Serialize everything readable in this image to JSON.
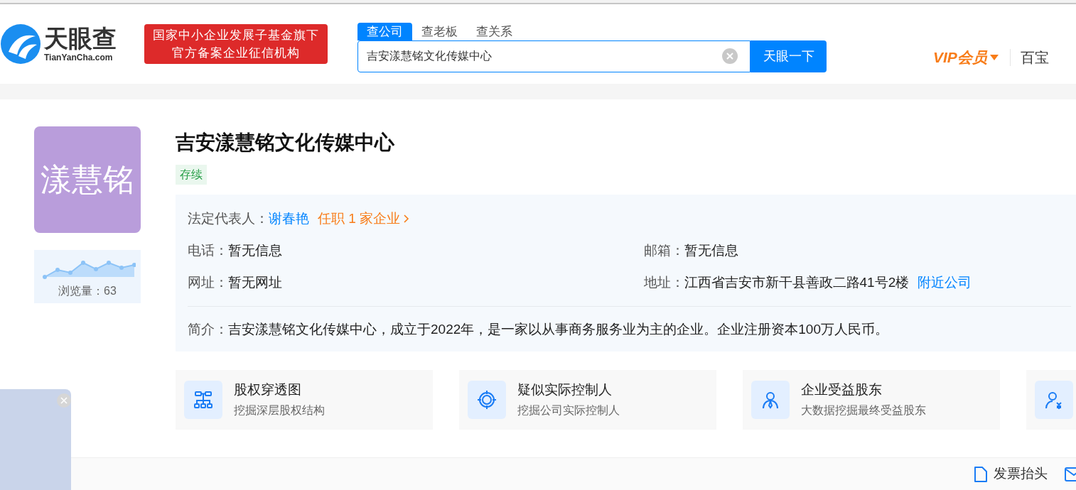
{
  "header": {
    "logo": {
      "name": "天眼查",
      "domain": "TianYanCha.com"
    },
    "badge_lines": [
      "国家中小企业发展子基金旗下",
      "官方备案企业征信机构"
    ],
    "search": {
      "tabs": [
        {
          "label": "查公司",
          "selected": true
        },
        {
          "label": "查老板",
          "selected": false
        },
        {
          "label": "查关系",
          "selected": false
        }
      ],
      "value": "吉安漾慧铭文化传媒中心",
      "button": "天眼一下"
    },
    "vip": "VIP会员",
    "toolbox": "百宝"
  },
  "company": {
    "logo_text": "漾慧铭",
    "views": "浏览量：63",
    "name": "吉安漾慧铭文化传媒中心",
    "status": "存续",
    "legal_rep": {
      "label": "法定代表人：",
      "name": "谢春艳",
      "positions": "任职 1 家企业"
    },
    "fields": [
      {
        "label": "电话：",
        "value": "暂无信息"
      },
      {
        "label": "邮箱：",
        "value": "暂无信息"
      },
      {
        "label": "网址：",
        "value": "暂无网址"
      },
      {
        "label": "地址：",
        "value": "江西省吉安市新干县善政二路41号2楼",
        "link": "附近公司"
      }
    ],
    "intro": {
      "label": "简介：",
      "text": "吉安漾慧铭文化传媒中心，成立于2022年，是一家以从事商务服务业为主的企业。企业注册资本100万人民币。"
    }
  },
  "features": [
    {
      "kind": "tree",
      "title": "股权穿透图",
      "subtitle": "挖掘深层股权结构"
    },
    {
      "kind": "target",
      "title": "疑似实际控制人",
      "subtitle": "挖掘公司实际控制人"
    },
    {
      "kind": "person",
      "title": "企业受益股东",
      "subtitle": "大数据挖掘最终受益股东"
    },
    {
      "kind": "person-yen"
    }
  ],
  "footer_actions": [
    {
      "kind": "document",
      "label": "发票抬头"
    },
    {
      "kind": "mail"
    }
  ]
}
